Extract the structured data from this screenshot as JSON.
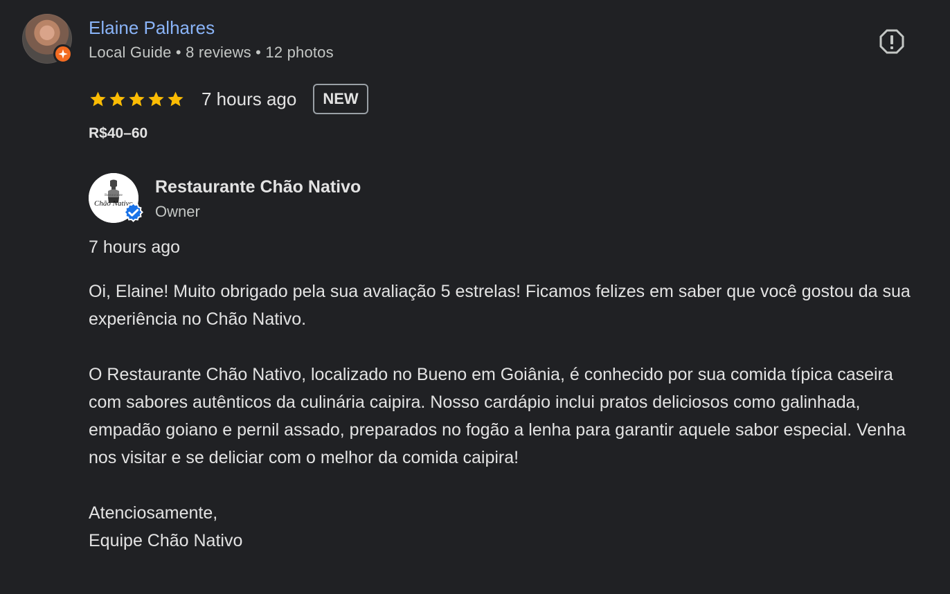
{
  "reviewer": {
    "name": "Elaine Palhares",
    "meta": "Local Guide • 8 reviews • 12 photos",
    "avatar": "reviewer-avatar",
    "badge_icon": "local-guide-icon",
    "badge_color": "#f36b21"
  },
  "review": {
    "rating": 5,
    "max_rating": 5,
    "time": "7 hours ago",
    "badge": "NEW",
    "price_range": "R$40–60",
    "star_color": "#fbbc04"
  },
  "report": {
    "icon": "report-icon"
  },
  "owner_reply": {
    "name": "Restaurante Chão Nativo",
    "role": "Owner",
    "time": "7 hours ago",
    "logo_icon": "restaurant-logo",
    "verified_icon": "verified-icon",
    "verified_color": "#1a73e8",
    "paragraphs": [
      "Oi, Elaine! Muito obrigado pela sua avaliação 5 estrelas! Ficamos felizes em saber que você gostou da sua experiência no Chão Nativo.",
      "O Restaurante Chão Nativo, localizado no Bueno em Goiânia, é conhecido por sua comida típica caseira com sabores autênticos da culinária caipira. Nosso cardápio inclui pratos deliciosos como galinhada, empadão goiano e pernil assado, preparados no fogão a lenha para garantir aquele sabor especial. Venha nos visitar e se deliciar com o melhor da comida caipira!"
    ],
    "closing": "Atenciosamente,",
    "signature": "Equipe Chão Nativo",
    "logo_text": {
      "line1": "Restaurante",
      "line2": "Chão Nativo"
    }
  }
}
